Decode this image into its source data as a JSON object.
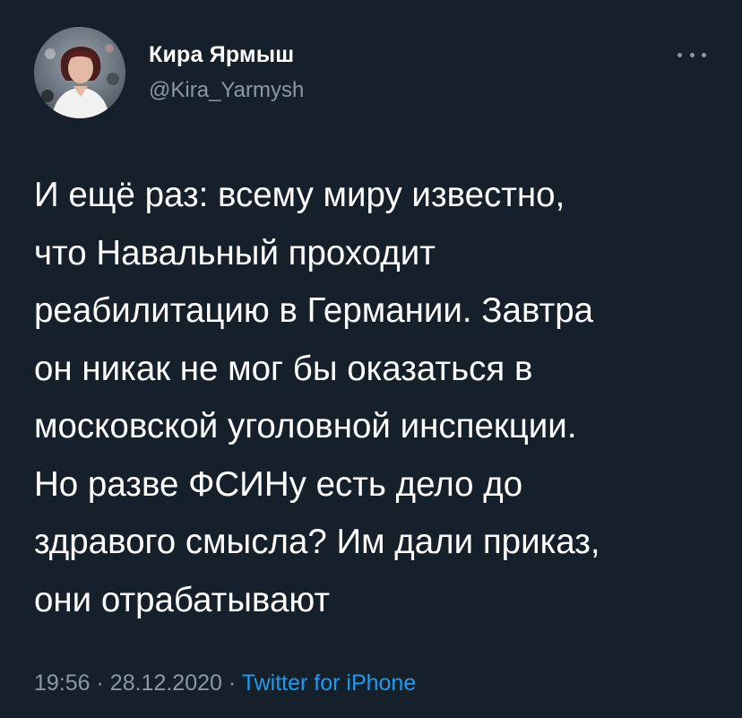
{
  "tweet": {
    "author": {
      "display_name": "Кира Ярмыш",
      "handle": "@Kira_Yarmysh"
    },
    "text_lines": [
      "И ещё раз: всему миру известно,",
      "что Навальный проходит",
      "реабилитацию в Германии. Завтра",
      "он никак не мог бы оказаться в",
      "московской уголовной инспекции.",
      "Но разве ФСИНу есть дело до",
      "здравого смысла? Им дали приказ,",
      "они отрабатывают"
    ],
    "time": "19:56",
    "separator": "·",
    "date": "28.12.2020",
    "source": "Twitter for iPhone"
  },
  "icons": {
    "more": "more-horizontal-icon"
  },
  "colors": {
    "background": "#15202b",
    "text_primary": "#ffffff",
    "text_secondary": "#8b98a5",
    "accent": "#1d9bf0"
  }
}
